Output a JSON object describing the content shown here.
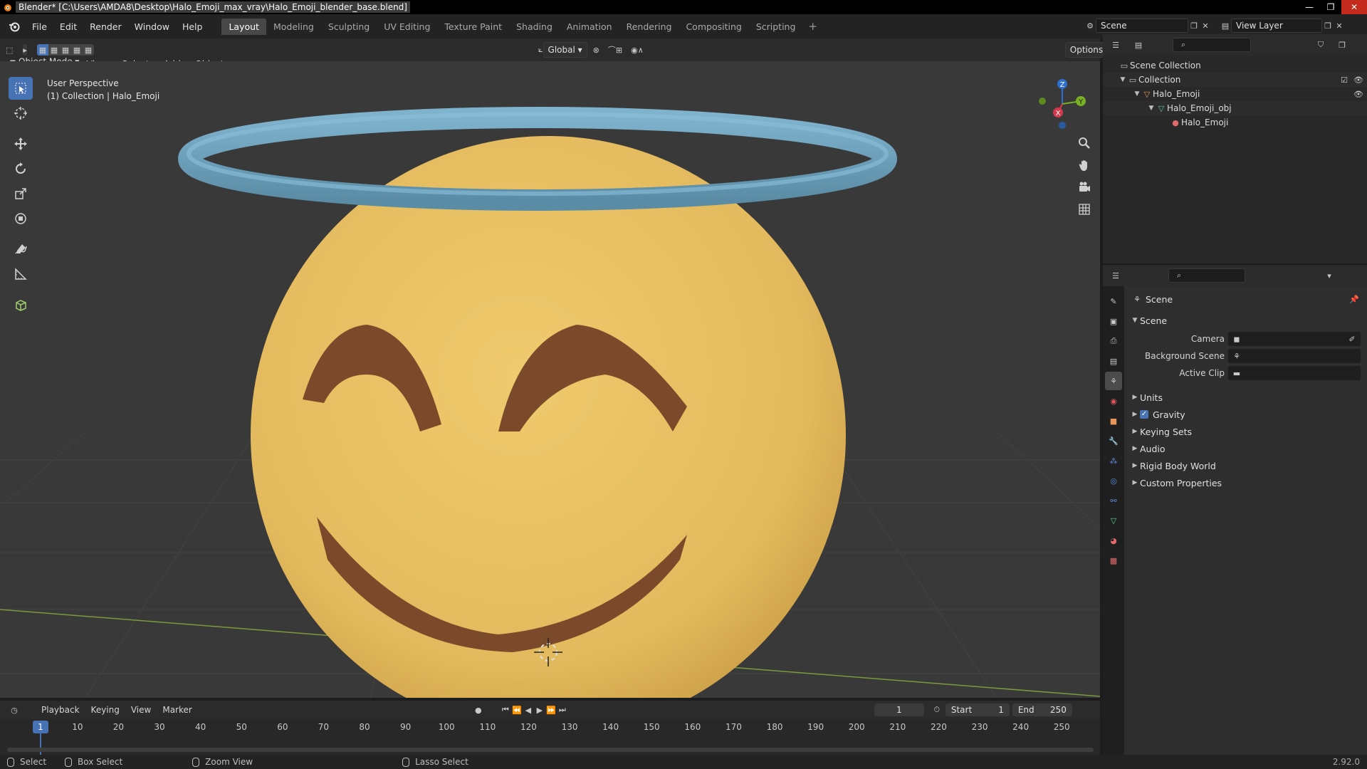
{
  "window": {
    "title": "Blender* [C:\\Users\\AMDA8\\Desktop\\Halo_Emoji_max_vray\\Halo_Emoji_blender_base.blend]",
    "minimize": "—",
    "maximize": "❐",
    "close": "✕"
  },
  "menu": {
    "items": [
      "File",
      "Edit",
      "Render",
      "Window",
      "Help"
    ]
  },
  "workspaces": {
    "tabs": [
      "Layout",
      "Modeling",
      "Sculpting",
      "UV Editing",
      "Texture Paint",
      "Shading",
      "Animation",
      "Rendering",
      "Compositing",
      "Scripting"
    ],
    "active": "Layout",
    "add": "+"
  },
  "scene_selector": {
    "scene": "Scene",
    "view_layer": "View Layer"
  },
  "viewport_header": {
    "mode": "Object Mode",
    "menus": [
      "View",
      "Select",
      "Add",
      "Object"
    ],
    "orientation": "Global",
    "options": "Options"
  },
  "viewport": {
    "perspective": "User Perspective",
    "collection": "(1) Collection | Halo_Emoji",
    "colors": {
      "face": "#e8c063",
      "halo": "#6ea2bd",
      "mouth": "#7b4a2a",
      "grid": "#3a3a3a"
    },
    "gizmo": {
      "z": "Z",
      "y": "Y",
      "x": "X"
    }
  },
  "outliner": {
    "rows": [
      {
        "label": "Scene Collection",
        "icon": "collection-icon"
      },
      {
        "label": "Collection",
        "icon": "collection-icon"
      },
      {
        "label": "Halo_Emoji",
        "icon": "object-icon"
      },
      {
        "label": "Halo_Emoji_obj",
        "icon": "mesh-icon"
      },
      {
        "label": "Halo_Emoji",
        "icon": "material-icon"
      }
    ]
  },
  "properties": {
    "title": "Scene",
    "panel_title": "Scene",
    "fields": [
      {
        "label": "Camera"
      },
      {
        "label": "Background Scene"
      },
      {
        "label": "Active Clip"
      }
    ],
    "sections": [
      "Units",
      "Gravity",
      "Keying Sets",
      "Audio",
      "Rigid Body World",
      "Custom Properties"
    ],
    "gravity_checked": true
  },
  "timeline": {
    "menus": [
      "Playback",
      "Keying",
      "View",
      "Marker"
    ],
    "current_frame": "1",
    "start_label": "Start",
    "start": "1",
    "end_label": "End",
    "end": "250",
    "ticks": [
      "1",
      "10",
      "20",
      "30",
      "40",
      "50",
      "60",
      "70",
      "80",
      "90",
      "100",
      "110",
      "120",
      "130",
      "140",
      "150",
      "160",
      "170",
      "180",
      "190",
      "200",
      "210",
      "220",
      "230",
      "240",
      "250"
    ]
  },
  "statusbar": {
    "items": [
      "Select",
      "Box Select",
      "Zoom View",
      "Lasso Select"
    ],
    "version": "2.92.0"
  }
}
